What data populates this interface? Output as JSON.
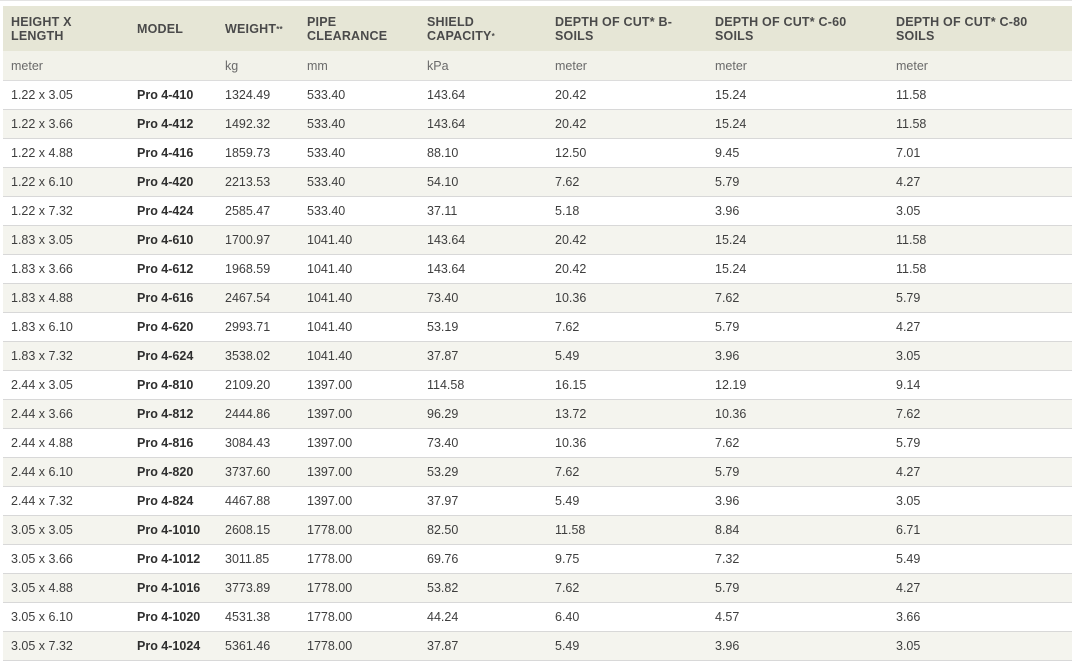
{
  "headers": [
    {
      "label": "Height X Length",
      "mark": ""
    },
    {
      "label": "Model",
      "mark": ""
    },
    {
      "label": "Weight",
      "mark": "**"
    },
    {
      "label": "Pipe Clearance",
      "mark": ""
    },
    {
      "label": "Shield Capacity",
      "mark": "*"
    },
    {
      "label": "Depth of Cut* B-Soils",
      "mark": ""
    },
    {
      "label": "Depth of Cut* C-60 Soils",
      "mark": ""
    },
    {
      "label": "Depth of Cut* C-80 Soils",
      "mark": ""
    }
  ],
  "units": [
    "meter",
    "",
    "kg",
    "mm",
    "kPa",
    "meter",
    "meter",
    "meter"
  ],
  "rows": [
    [
      "1.22 x 3.05",
      "Pro 4-410",
      "1324.49",
      "533.40",
      "143.64",
      "20.42",
      "15.24",
      "11.58"
    ],
    [
      "1.22 x 3.66",
      "Pro 4-412",
      "1492.32",
      "533.40",
      "143.64",
      "20.42",
      "15.24",
      "11.58"
    ],
    [
      "1.22 x 4.88",
      "Pro 4-416",
      "1859.73",
      "533.40",
      "88.10",
      "12.50",
      "9.45",
      "7.01"
    ],
    [
      "1.22 x 6.10",
      "Pro 4-420",
      "2213.53",
      "533.40",
      "54.10",
      "7.62",
      "5.79",
      "4.27"
    ],
    [
      "1.22 x 7.32",
      "Pro 4-424",
      "2585.47",
      "533.40",
      "37.11",
      "5.18",
      "3.96",
      "3.05"
    ],
    [
      "1.83 x 3.05",
      "Pro 4-610",
      "1700.97",
      "1041.40",
      "143.64",
      "20.42",
      "15.24",
      "11.58"
    ],
    [
      "1.83 x 3.66",
      "Pro 4-612",
      "1968.59",
      "1041.40",
      "143.64",
      "20.42",
      "15.24",
      "11.58"
    ],
    [
      "1.83 x 4.88",
      "Pro 4-616",
      "2467.54",
      "1041.40",
      "73.40",
      "10.36",
      "7.62",
      "5.79"
    ],
    [
      "1.83 x 6.10",
      "Pro 4-620",
      "2993.71",
      "1041.40",
      "53.19",
      "7.62",
      "5.79",
      "4.27"
    ],
    [
      "1.83 x 7.32",
      "Pro 4-624",
      "3538.02",
      "1041.40",
      "37.87",
      "5.49",
      "3.96",
      "3.05"
    ],
    [
      "2.44 x 3.05",
      "Pro 4-810",
      "2109.20",
      "1397.00",
      "114.58",
      "16.15",
      "12.19",
      "9.14"
    ],
    [
      "2.44 x 3.66",
      "Pro 4-812",
      "2444.86",
      "1397.00",
      "96.29",
      "13.72",
      "10.36",
      "7.62"
    ],
    [
      "2.44 x 4.88",
      "Pro 4-816",
      "3084.43",
      "1397.00",
      "73.40",
      "10.36",
      "7.62",
      "5.79"
    ],
    [
      "2.44 x 6.10",
      "Pro 4-820",
      "3737.60",
      "1397.00",
      "53.29",
      "7.62",
      "5.79",
      "4.27"
    ],
    [
      "2.44 x 7.32",
      "Pro 4-824",
      "4467.88",
      "1397.00",
      "37.97",
      "5.49",
      "3.96",
      "3.05"
    ],
    [
      "3.05 x 3.05",
      "Pro 4-1010",
      "2608.15",
      "1778.00",
      "82.50",
      "11.58",
      "8.84",
      "6.71"
    ],
    [
      "3.05 x 3.66",
      "Pro 4-1012",
      "3011.85",
      "1778.00",
      "69.76",
      "9.75",
      "7.32",
      "5.49"
    ],
    [
      "3.05 x 4.88",
      "Pro 4-1016",
      "3773.89",
      "1778.00",
      "53.82",
      "7.62",
      "5.79",
      "4.27"
    ],
    [
      "3.05 x 6.10",
      "Pro 4-1020",
      "4531.38",
      "1778.00",
      "44.24",
      "6.40",
      "4.57",
      "3.66"
    ],
    [
      "3.05 x 7.32",
      "Pro 4-1024",
      "5361.46",
      "1778.00",
      "37.87",
      "5.49",
      "3.96",
      "3.05"
    ]
  ],
  "colors": {
    "header_bg": "#e6e6d6",
    "unit_bg": "#f2f2ea",
    "stripe_bg": "#f4f4ee",
    "text": "#3e3e3e"
  }
}
